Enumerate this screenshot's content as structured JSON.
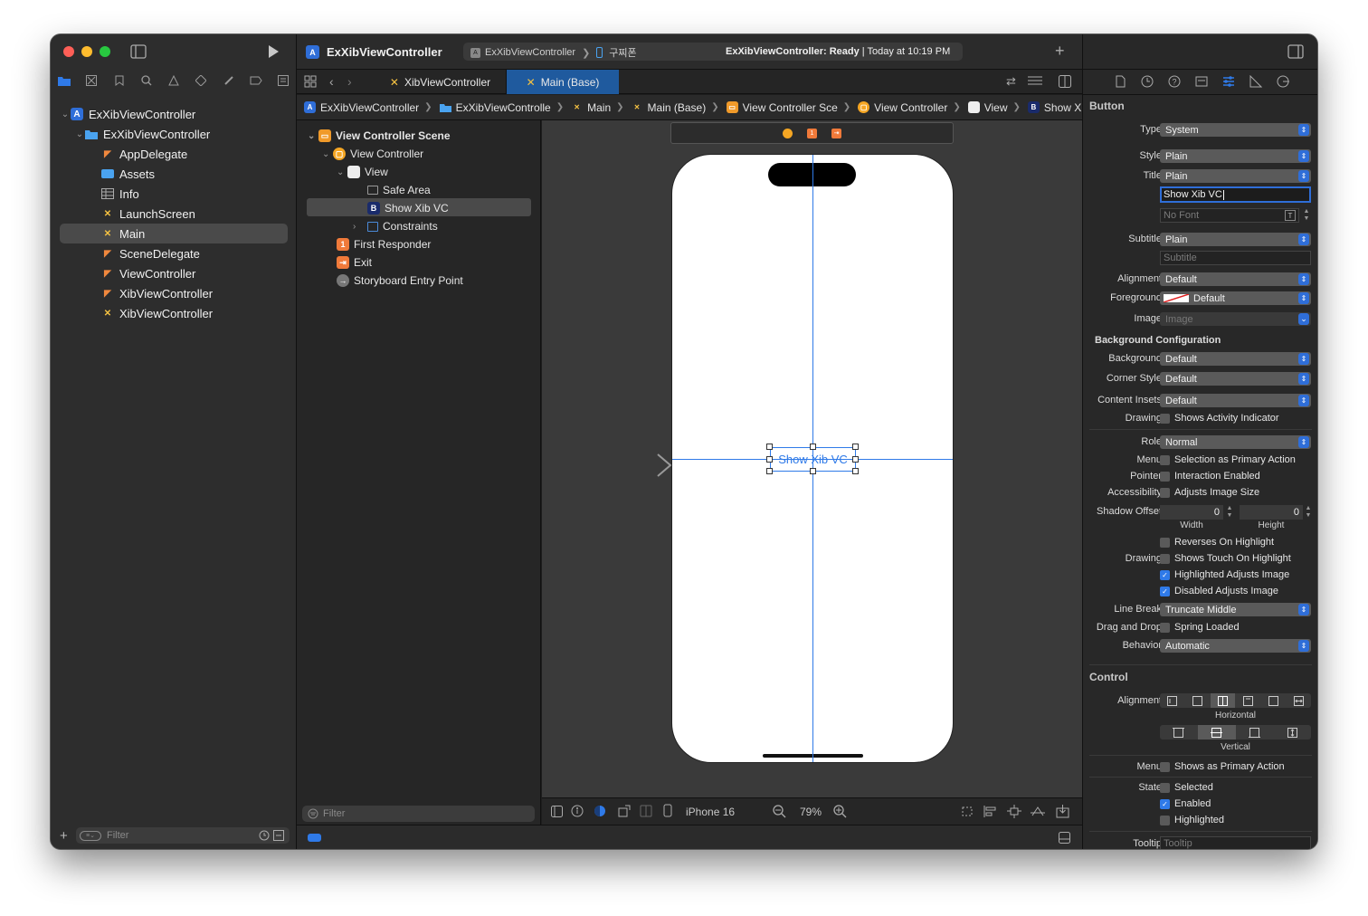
{
  "window": {
    "title": "ExXibViewController",
    "status": "ExXibViewController: Ready | Today at 10:19 PM",
    "status_bold": "ExXibViewController: Ready",
    "status_rest": " | Today at 10:19 PM",
    "scheme": "ExXibViewController",
    "device": "구찌폰"
  },
  "colors": {
    "accent": "#2f6ed8",
    "selected_tab": "#1f5a9e",
    "swift": "#f0883e",
    "storyboard": "#f5c242",
    "folder": "#4aa3f0"
  },
  "navigator": {
    "items": [
      {
        "label": "ExXibViewController",
        "icon": "xcode-project-icon"
      },
      {
        "label": "ExXibViewController",
        "icon": "folder-icon"
      },
      {
        "label": "AppDelegate",
        "icon": "swift-icon"
      },
      {
        "label": "Assets",
        "icon": "assets-icon"
      },
      {
        "label": "Info",
        "icon": "plist-icon"
      },
      {
        "label": "LaunchScreen",
        "icon": "storyboard-icon"
      },
      {
        "label": "Main",
        "icon": "storyboard-icon"
      },
      {
        "label": "SceneDelegate",
        "icon": "swift-icon"
      },
      {
        "label": "ViewController",
        "icon": "swift-icon"
      },
      {
        "label": "XibViewController",
        "icon": "swift-icon"
      },
      {
        "label": "XibViewController",
        "icon": "xib-icon"
      }
    ],
    "filter_placeholder": "Filter"
  },
  "tabs": [
    {
      "label": "XibViewController"
    },
    {
      "label": "Main (Base)"
    }
  ],
  "breadcrumb": [
    "ExXibViewController",
    "ExXibViewControlle",
    "Main",
    "Main (Base)",
    "View Controller Sce",
    "View Controller",
    "View",
    "Show Xib VC"
  ],
  "outline": {
    "items": [
      {
        "label": "View Controller Scene"
      },
      {
        "label": "View Controller"
      },
      {
        "label": "View"
      },
      {
        "label": "Safe Area"
      },
      {
        "label": "Show Xib VC"
      },
      {
        "label": "Constraints"
      },
      {
        "label": "First Responder"
      },
      {
        "label": "Exit"
      },
      {
        "label": "Storyboard Entry Point"
      }
    ],
    "filter_placeholder": "Filter"
  },
  "canvas": {
    "button_label": "Show Xib VC",
    "device": "iPhone 16",
    "zoom": "79%",
    "button_badge": "B",
    "responder_badge": "1"
  },
  "inspector": {
    "section_button": "Button",
    "type": {
      "label": "Type",
      "value": "System"
    },
    "style": {
      "label": "Style",
      "value": "Plain"
    },
    "title": {
      "label": "Title",
      "value": "Plain",
      "text": "Show Xib VC",
      "font_placeholder": "No Font"
    },
    "subtitle": {
      "label": "Subtitle",
      "value": "Plain",
      "placeholder": "Subtitle"
    },
    "alignment": {
      "label": "Alignment",
      "value": "Default"
    },
    "foreground": {
      "label": "Foreground",
      "value": "Default"
    },
    "image": {
      "label": "Image",
      "placeholder": "Image"
    },
    "bg_config": "Background Configuration",
    "background": {
      "label": "Background",
      "value": "Default"
    },
    "corner_style": {
      "label": "Corner Style",
      "value": "Default"
    },
    "content_insets": {
      "label": "Content Insets",
      "value": "Default"
    },
    "drawing1": {
      "label": "Drawing",
      "check": "Shows Activity Indicator"
    },
    "role": {
      "label": "Role",
      "value": "Normal"
    },
    "menu": {
      "label": "Menu",
      "check": "Selection as Primary Action"
    },
    "pointer": {
      "label": "Pointer",
      "check": "Interaction Enabled"
    },
    "accessibility": {
      "label": "Accessibility",
      "check": "Adjusts Image Size"
    },
    "shadow": {
      "label": "Shadow Offset",
      "width": "0",
      "height": "0",
      "width_label": "Width",
      "height_label": "Height"
    },
    "reverses": "Reverses On Highlight",
    "drawing2": {
      "label": "Drawing",
      "check": "Shows Touch On Highlight"
    },
    "highlighted_adjusts": "Highlighted Adjusts Image",
    "disabled_adjusts": "Disabled Adjusts Image",
    "line_break": {
      "label": "Line Break",
      "value": "Truncate Middle"
    },
    "drag_drop": {
      "label": "Drag and Drop",
      "check": "Spring Loaded"
    },
    "behavior": {
      "label": "Behavior",
      "value": "Automatic"
    },
    "section_control": "Control",
    "ctrl_alignment": {
      "label": "Alignment",
      "horizontal": "Horizontal",
      "vertical": "Vertical"
    },
    "ctrl_menu": {
      "label": "Menu",
      "check": "Shows as Primary Action"
    },
    "state": {
      "label": "State",
      "selected": "Selected",
      "enabled": "Enabled",
      "highlighted": "Highlighted"
    },
    "tooltip": {
      "label": "Tooltip",
      "placeholder": "Tooltip"
    }
  }
}
